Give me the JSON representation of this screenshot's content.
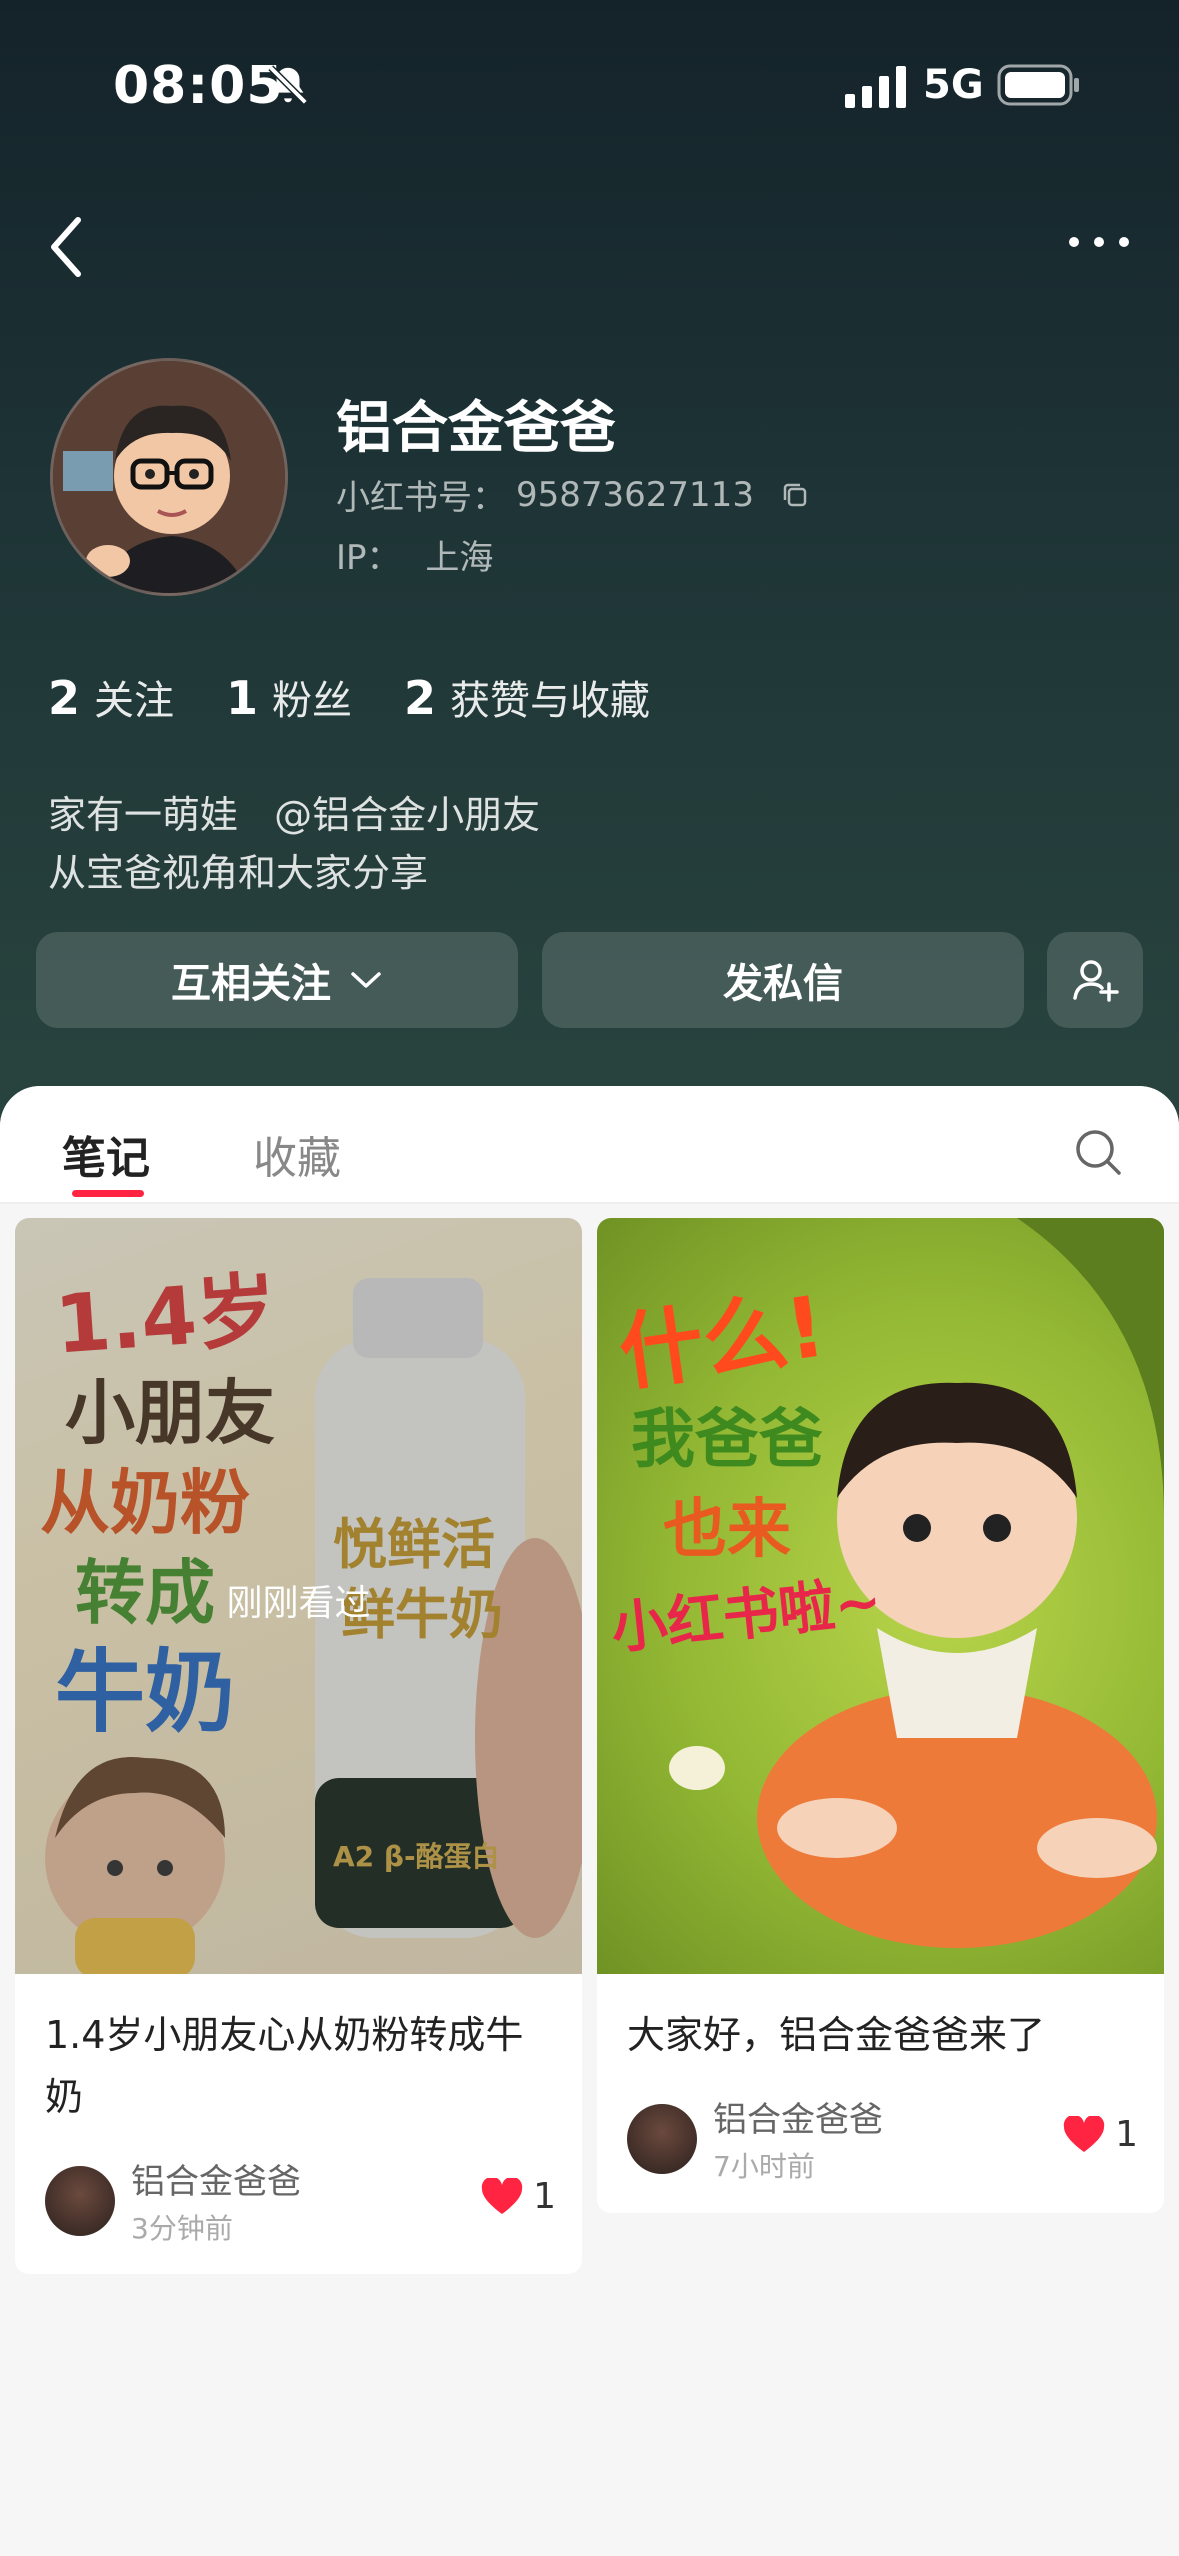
{
  "status_bar": {
    "time": "08:05",
    "network": "5G"
  },
  "profile": {
    "name": "铝合金爸爸",
    "uid_label": "小红书号：",
    "uid": "95873627113",
    "ip_label": "IP：",
    "ip_location": "上海"
  },
  "stats": [
    {
      "num": "2",
      "label": "关注"
    },
    {
      "num": "1",
      "label": "粉丝"
    },
    {
      "num": "2",
      "label": "获赞与收藏"
    }
  ],
  "bio": {
    "line1": "家有一萌娃",
    "mention": "@铝合金小朋友",
    "line2": "从宝爸视角和大家分享"
  },
  "actions": {
    "follow_label": "互相关注",
    "message_label": "发私信"
  },
  "tabs": {
    "notes": "笔记",
    "collections": "收藏"
  },
  "notes": [
    {
      "title": "1.4岁小朋友心从奶粉转成牛奶",
      "seen_label": "刚刚看过",
      "author": "铝合金爸爸",
      "time": "3分钟前",
      "likes": "1",
      "cover_text": {
        "line1": "1.4岁",
        "line2": "小朋友",
        "line3": "从奶粉",
        "line4": "转成",
        "line5": "牛奶",
        "bottle1": "悦鲜活",
        "bottle2": "鲜牛奶",
        "bottle3": "A2 β-酪蛋白"
      }
    },
    {
      "title": "大家好，铝合金爸爸来了",
      "author": "铝合金爸爸",
      "time": "7小时前",
      "likes": "1",
      "cover_text": {
        "line1": "什么!",
        "line2": "我爸爸",
        "line3": "也来",
        "line4": "小红书啦~"
      }
    }
  ],
  "colors": {
    "accent": "#ff2442",
    "header_bg": "#1e3436"
  }
}
